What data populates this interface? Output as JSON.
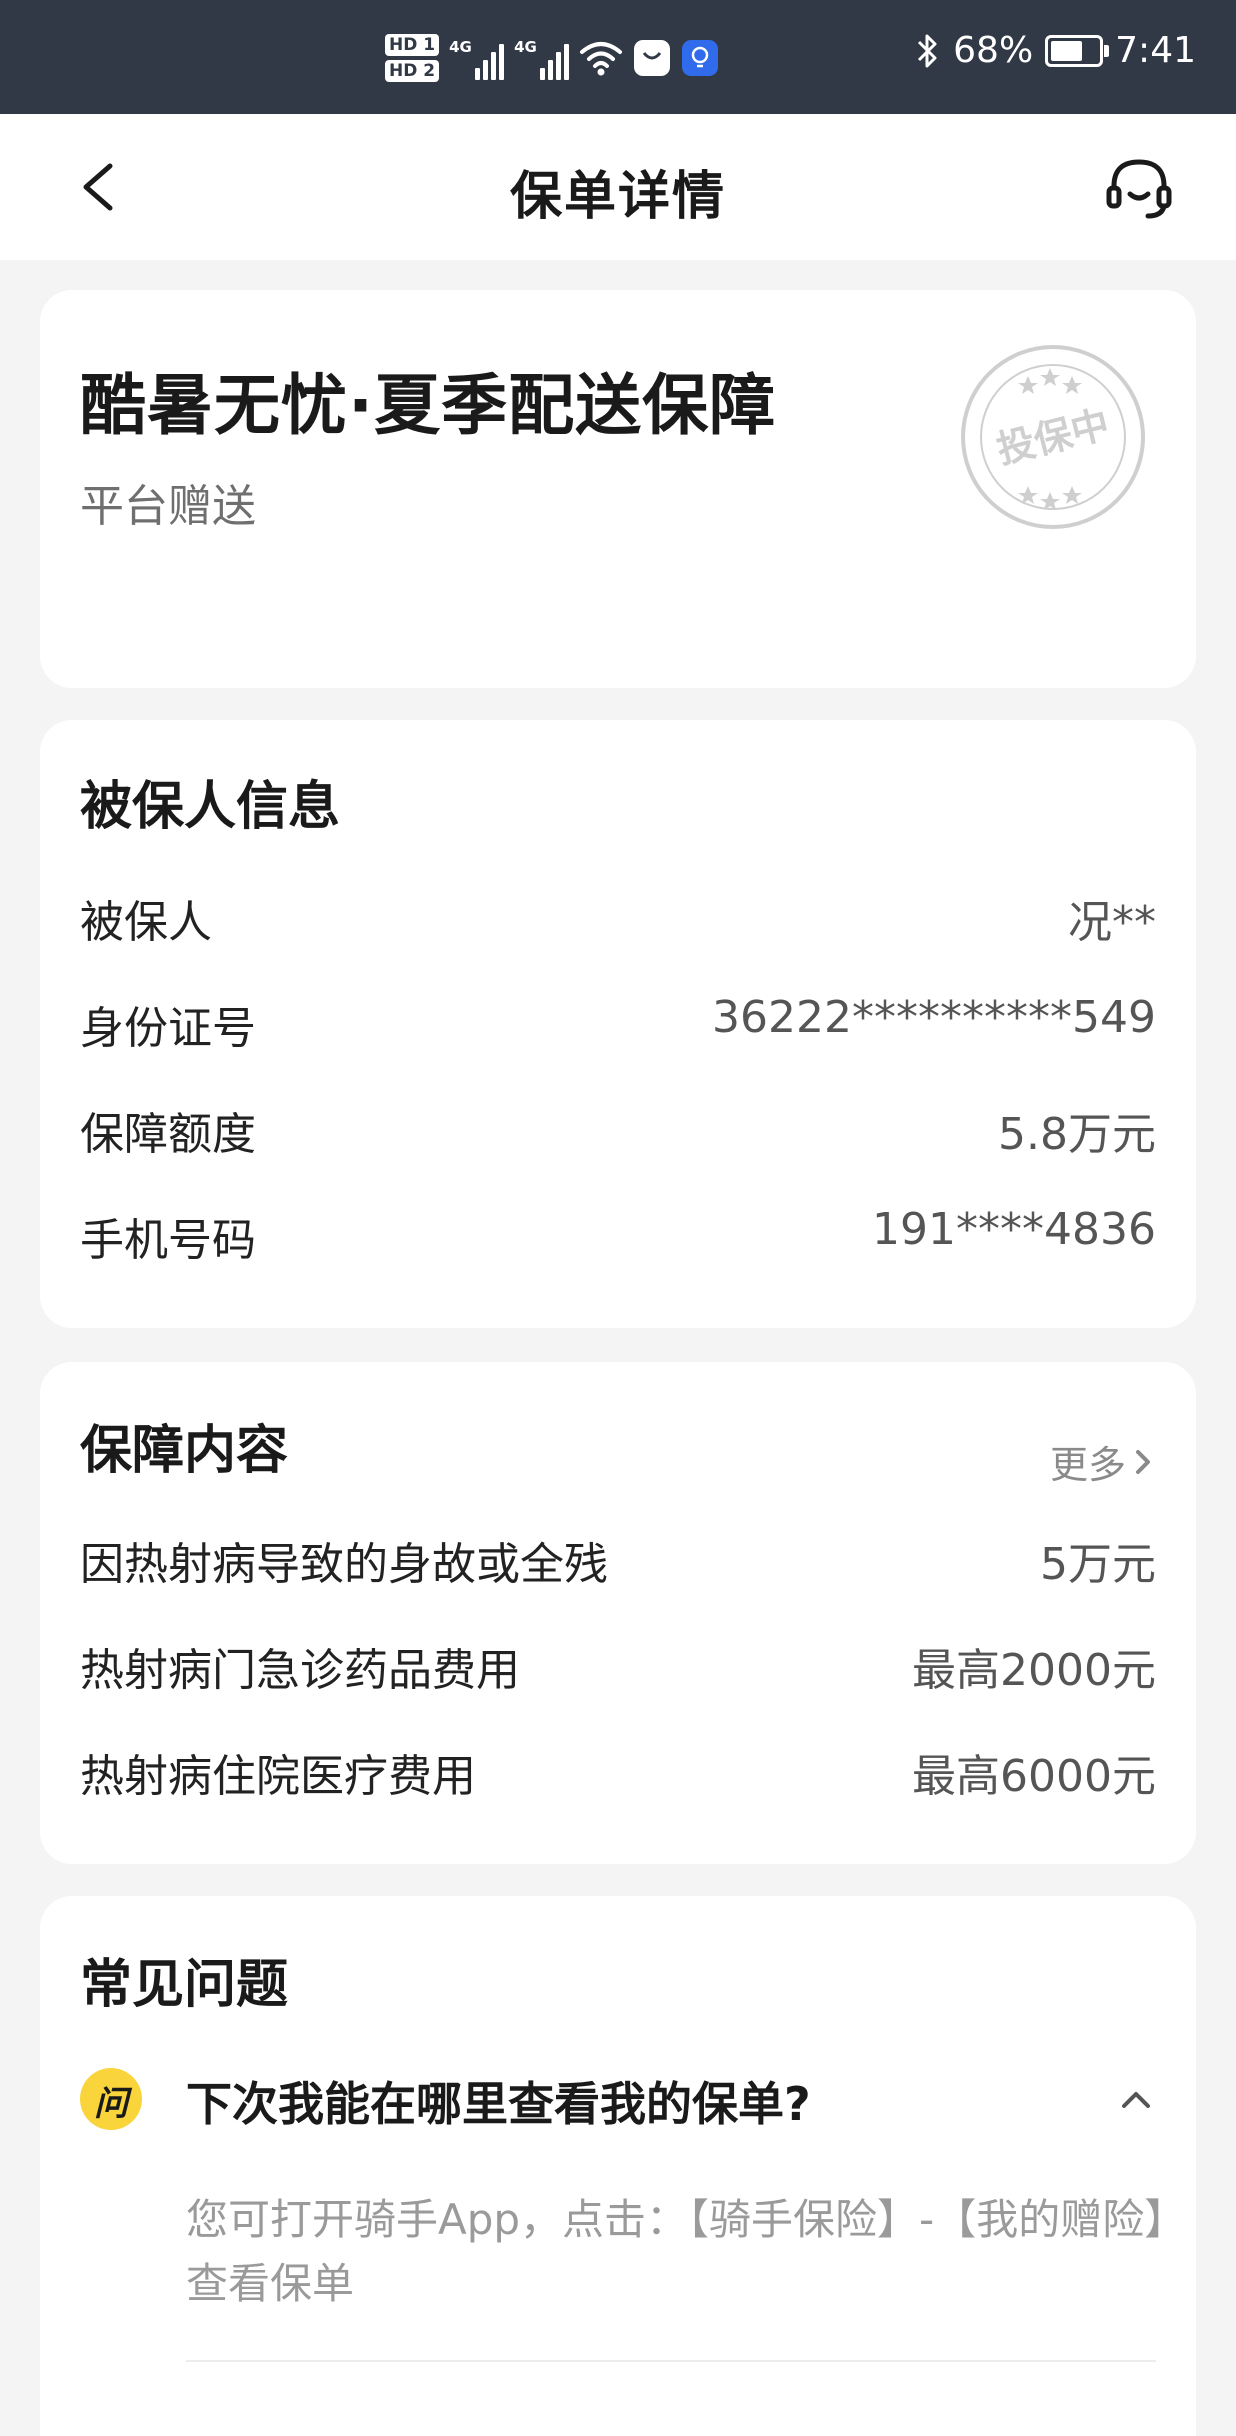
{
  "status_bar": {
    "hd1": "HD 1",
    "hd2": "HD 2",
    "net1": "4G",
    "net2": "4G",
    "battery_pct": "68%",
    "battery_level": 0.68,
    "time": "7:41"
  },
  "nav": {
    "title": "保单详情"
  },
  "policy": {
    "title": "酷暑无忧·夏季配送保障",
    "subtitle": "平台赠送",
    "stamp_text": "投保中"
  },
  "insured": {
    "section_title": "被保人信息",
    "rows": [
      {
        "label": "被保人",
        "value": "况**"
      },
      {
        "label": "身份证号",
        "value": "36222**********549"
      },
      {
        "label": "保障额度",
        "value": "5.8万元"
      },
      {
        "label": "手机号码",
        "value": "191****4836"
      }
    ]
  },
  "coverage": {
    "section_title": "保障内容",
    "more_label": "更多",
    "rows": [
      {
        "label": "因热射病导致的身故或全残",
        "value": "5万元"
      },
      {
        "label": "热射病门急诊药品费用",
        "value": "最高2000元"
      },
      {
        "label": "热射病住院医疗费用",
        "value": "最高6000元"
      }
    ]
  },
  "faq": {
    "section_title": "常见问题",
    "badge": "问",
    "items": [
      {
        "question": "下次我能在哪里查看我的保单?",
        "answer": "您可打开骑手App，点击：【骑手保险】-【我的赠险】查看保单"
      }
    ]
  },
  "colors": {
    "status_bar_bg": "#323946",
    "page_bg": "#f4f4f4",
    "card_bg": "#ffffff",
    "faq_badge": "#f9d43a",
    "stamp": "#c8c8c8"
  },
  "icons": {
    "back": "chevron-left-icon",
    "service": "headset-icon",
    "more": "chevron-right-icon",
    "toggle": "chevron-up-icon",
    "bluetooth": "bluetooth-icon",
    "wifi": "wifi-icon"
  }
}
